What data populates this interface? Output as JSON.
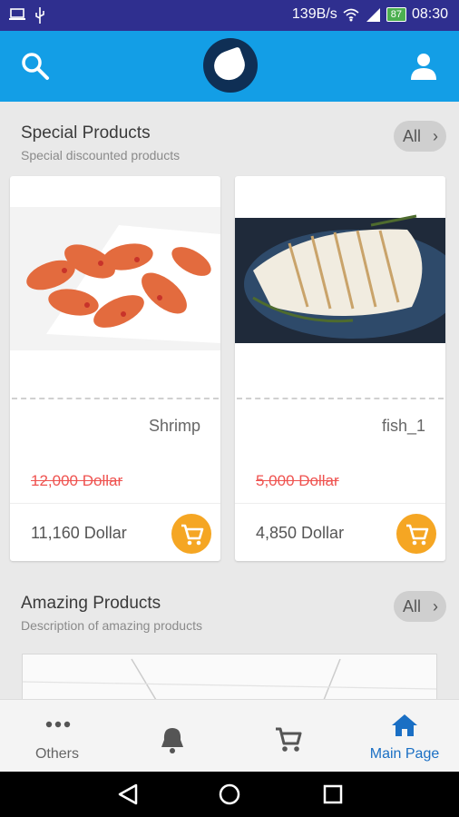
{
  "status_bar": {
    "speed": "139B/s",
    "battery": "87",
    "time": "08:30"
  },
  "app_bar": {
    "search_icon": "search-icon",
    "user_icon": "user-icon",
    "logo_icon": "logo-icon"
  },
  "special": {
    "title": "Special Products",
    "subtitle": "Special discounted products",
    "all_label": "All"
  },
  "products": [
    {
      "name": "Shrimp",
      "old_price": "12,000 Dollar",
      "new_price": "11,160 Dollar",
      "image_icon": "shrimp-photo"
    },
    {
      "name": "fish_1",
      "old_price": "5,000 Dollar",
      "new_price": "4,850 Dollar",
      "image_icon": "fish-photo"
    }
  ],
  "amazing": {
    "title": "Amazing Products",
    "subtitle": "Description of amazing products",
    "all_label": "All"
  },
  "bottom_nav": {
    "items": [
      {
        "label": "Others",
        "icon": "more-icon"
      },
      {
        "label": "",
        "icon": "bell-icon"
      },
      {
        "label": "",
        "icon": "cart-icon"
      },
      {
        "label": "Main Page",
        "icon": "home-icon"
      }
    ]
  },
  "colors": {
    "app_bar": "#139ee6",
    "status_bar": "#2f2f8f",
    "accent": "#f5a623",
    "old_price": "#ef5350",
    "active_nav": "#1a6fc4"
  }
}
